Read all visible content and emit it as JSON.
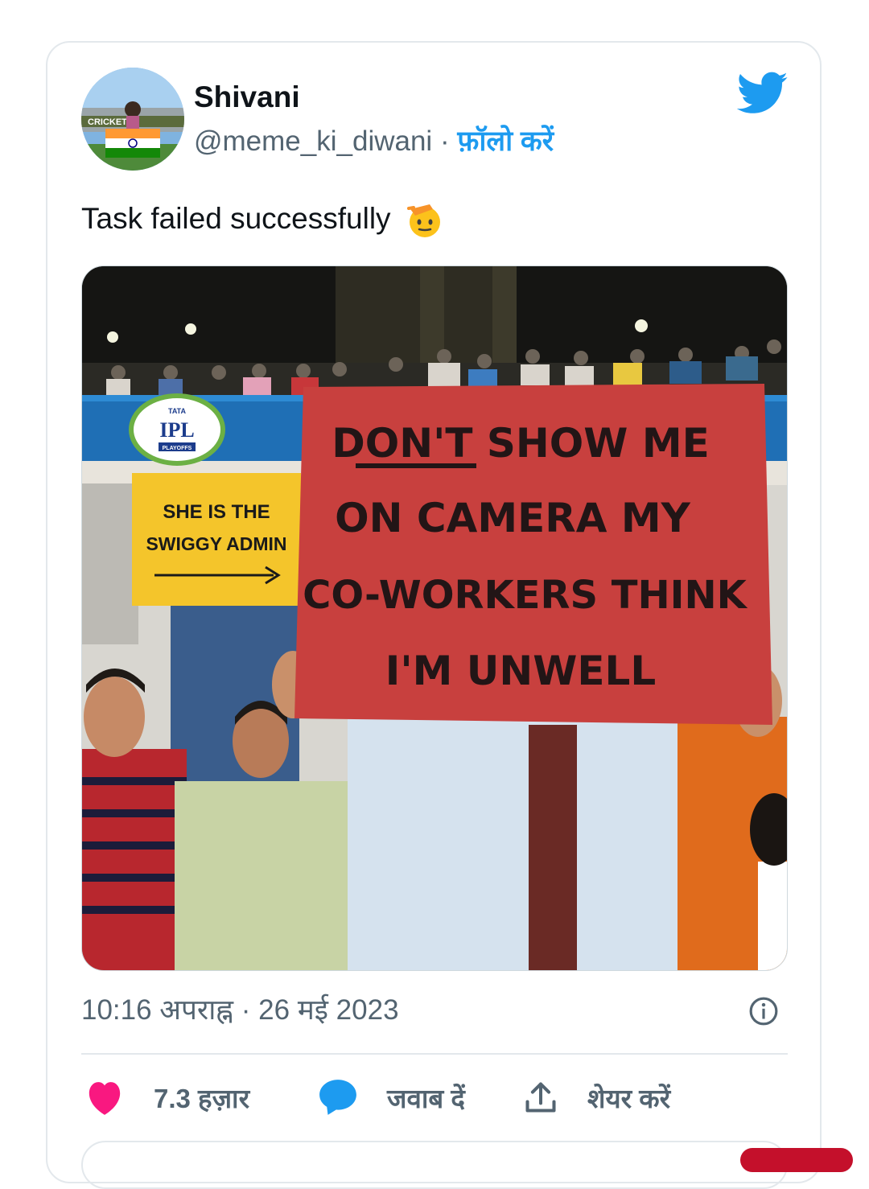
{
  "author": {
    "name": "Shivani",
    "handle": "@meme_ki_diwani",
    "separator": "·",
    "follow_label": "फ़ॉलो करें",
    "avatar_banner_text": "CRICKETKI"
  },
  "tweet": {
    "text": "Task failed successfully",
    "emoji": "saluting-face"
  },
  "photo": {
    "logo_top": "TATA",
    "logo_main": "IPL",
    "logo_sub": "PLAYOFFS",
    "yellow_sign": [
      "SHE IS THE",
      "SWIGGY ADMIN"
    ],
    "red_sign": [
      "DON'T SHOW ME",
      "ON CAMERA MY",
      "CO-WORKERS THINK",
      "I'M UNWELL"
    ]
  },
  "meta": {
    "timestamp": "10:16 अपराह्न · 26 मई 2023"
  },
  "actions": {
    "likes_label": "7.3 हज़ार",
    "reply_label": "जवाब दें",
    "share_label": "शेयर करें"
  },
  "colors": {
    "brand_blue": "#1d9bf0",
    "like_pink": "#f91880",
    "muted_text": "#536471"
  }
}
